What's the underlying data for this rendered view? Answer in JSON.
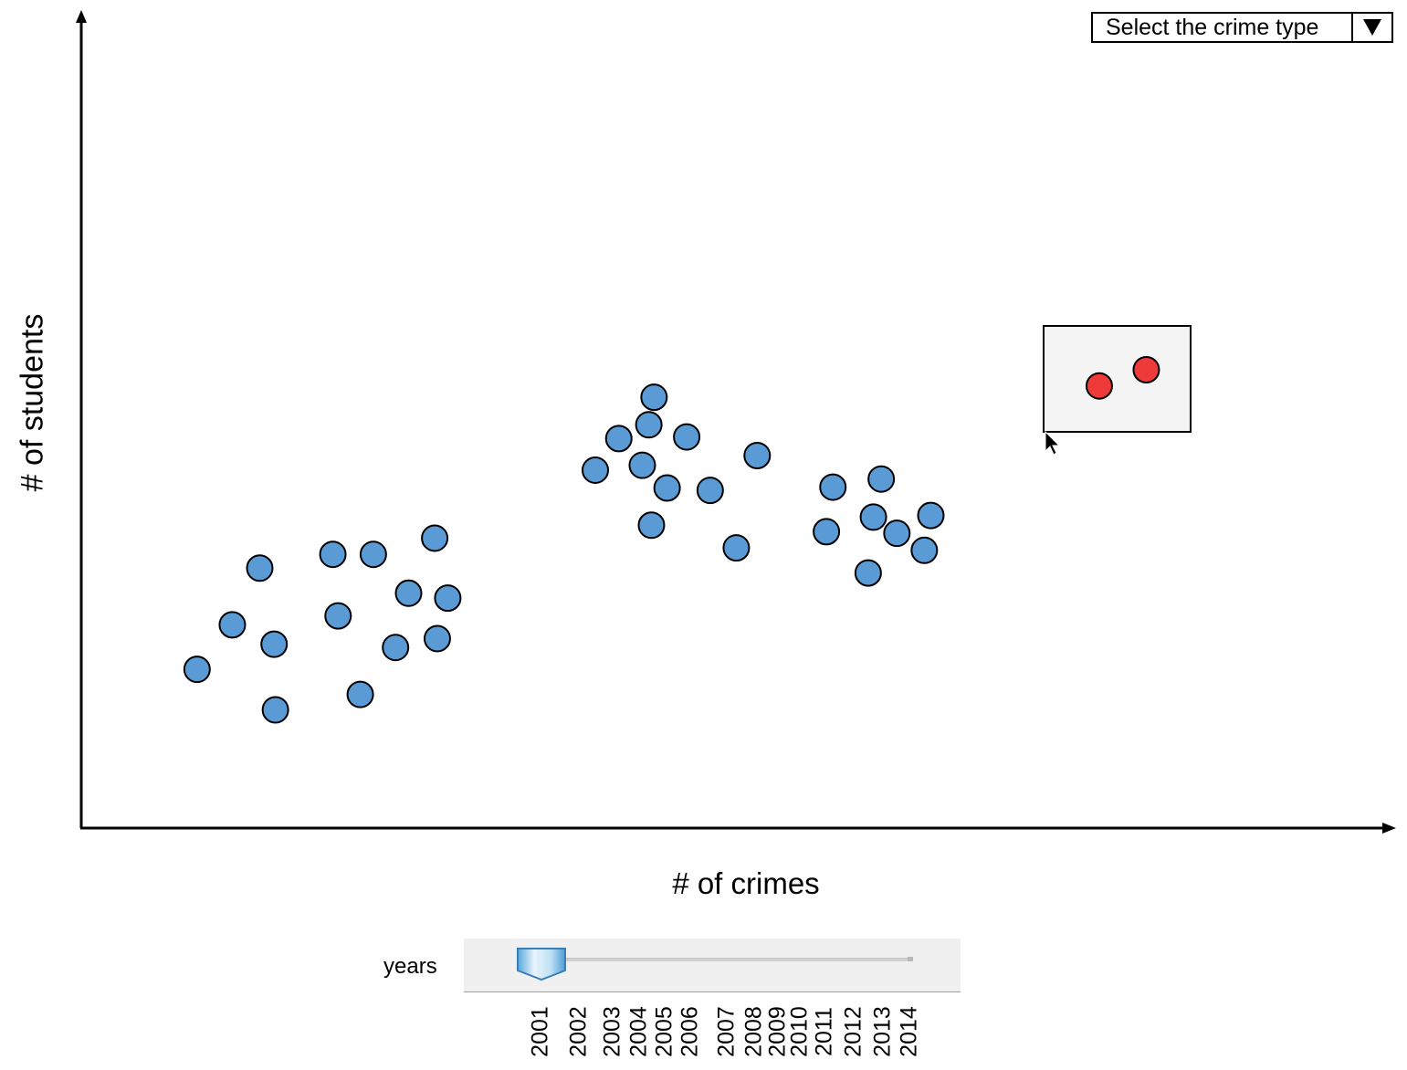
{
  "chart_data": {
    "type": "scatter",
    "xlabel": "# of crimes",
    "ylabel": "# of students",
    "xlim": [
      0,
      100
    ],
    "ylim": [
      0,
      100
    ],
    "point_color": "#5b9bd5",
    "highlight_color": "#ef3a3a",
    "points": [
      {
        "x": 8.8,
        "y": 19.6
      },
      {
        "x": 11.5,
        "y": 25.1
      },
      {
        "x": 13.6,
        "y": 32.1
      },
      {
        "x": 14.7,
        "y": 22.7
      },
      {
        "x": 14.8,
        "y": 14.6
      },
      {
        "x": 19.2,
        "y": 33.8
      },
      {
        "x": 19.6,
        "y": 26.2
      },
      {
        "x": 21.3,
        "y": 16.5
      },
      {
        "x": 22.3,
        "y": 33.8
      },
      {
        "x": 24.0,
        "y": 22.3
      },
      {
        "x": 25.0,
        "y": 29.0
      },
      {
        "x": 27.0,
        "y": 35.8
      },
      {
        "x": 27.2,
        "y": 23.4
      },
      {
        "x": 28.0,
        "y": 28.4
      },
      {
        "x": 39.3,
        "y": 44.2
      },
      {
        "x": 41.1,
        "y": 48.1
      },
      {
        "x": 42.9,
        "y": 44.8
      },
      {
        "x": 43.4,
        "y": 49.8
      },
      {
        "x": 43.6,
        "y": 37.4
      },
      {
        "x": 43.8,
        "y": 53.2
      },
      {
        "x": 44.8,
        "y": 42.0
      },
      {
        "x": 46.3,
        "y": 48.3
      },
      {
        "x": 48.1,
        "y": 41.7
      },
      {
        "x": 50.1,
        "y": 34.6
      },
      {
        "x": 51.7,
        "y": 46.0
      },
      {
        "x": 57.0,
        "y": 36.6
      },
      {
        "x": 57.5,
        "y": 42.1
      },
      {
        "x": 60.2,
        "y": 31.5
      },
      {
        "x": 60.6,
        "y": 38.4
      },
      {
        "x": 61.2,
        "y": 43.1
      },
      {
        "x": 62.4,
        "y": 36.4
      },
      {
        "x": 64.5,
        "y": 34.3
      },
      {
        "x": 65.0,
        "y": 38.6
      }
    ],
    "highlighted_points": [
      {
        "x": 77.9,
        "y": 54.6
      },
      {
        "x": 81.5,
        "y": 56.6
      }
    ]
  },
  "controls": {
    "crime_type_dropdown": {
      "label": "Select the crime type"
    },
    "years_slider": {
      "label": "years",
      "selected": "2001",
      "ticks": [
        "2001",
        "2002",
        "2003",
        "2004",
        "2005",
        "2006",
        "2007",
        "2008",
        "2009",
        "2010",
        "2011",
        "2012",
        "2013",
        "2014"
      ]
    }
  }
}
